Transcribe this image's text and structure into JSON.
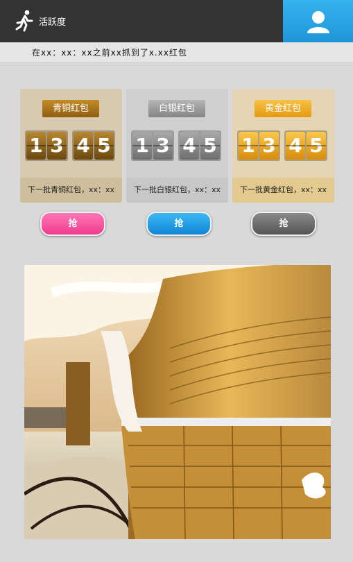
{
  "header": {
    "activity_label": "活跃度",
    "activity_icon": "running-person-icon",
    "user_icon": "user-icon"
  },
  "ticker": {
    "text": "在xx：xx：xx之前xx抓到了x.xx红包"
  },
  "cards": [
    {
      "tier": "bronze",
      "badge_label": "青铜红包",
      "digits": [
        "1",
        "3",
        "4",
        "5"
      ],
      "note": "下一批青铜红包，xx：xx"
    },
    {
      "tier": "silver",
      "badge_label": "白银红包",
      "digits": [
        "1",
        "3",
        "4",
        "5"
      ],
      "note": "下一批白银红包，xx：xx"
    },
    {
      "tier": "gold",
      "badge_label": "黄金红包",
      "digits": [
        "1",
        "3",
        "4",
        "5"
      ],
      "note": "下一批黄金红包，xx：xx"
    }
  ],
  "grab_buttons": [
    {
      "label": "抢",
      "color": "#f0489a"
    },
    {
      "label": "抢",
      "color": "#1e9be6"
    },
    {
      "label": "抢",
      "color": "#6e6e6e"
    }
  ],
  "colors": {
    "header_bg": "#333333",
    "user_button_bg": "#24a3e6",
    "page_bg": "#d9d9d9"
  }
}
